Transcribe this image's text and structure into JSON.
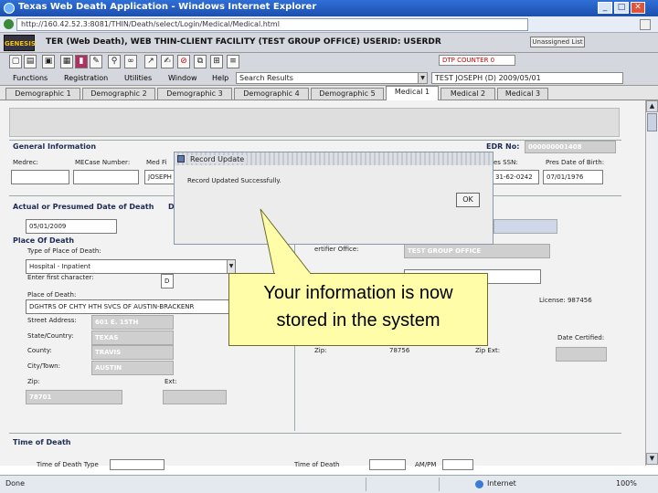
{
  "window": {
    "title": "Texas Web Death Application - Windows Internet Explorer",
    "address": "http://160.42.52.3:8081/THIN/Death/select/Login/Medical/Medical.html"
  },
  "header": {
    "logo": "GENESIS",
    "facility": "TER (Web Death), WEB THIN-CLIENT FACILITY (TEST GROUP OFFICE) USERID: USERDR",
    "unassign": "Unassigned List",
    "dtp_counter": "DTP COUNTER 0"
  },
  "menu": {
    "items": [
      "Functions",
      "Registration",
      "Utilities",
      "Window",
      "Help"
    ],
    "search_results": "Search Results",
    "patient": "TEST JOSEPH (D) 2009/05/01"
  },
  "tabs": [
    "Demographic 1",
    "Demographic 2",
    "Demographic 3",
    "Demographic 4",
    "Demographic 5",
    "Medical 1",
    "Medical 2",
    "Medical 3"
  ],
  "form": {
    "general_info": "General Information",
    "edr_label": "EDR No:",
    "edr_value": "000000001408",
    "medrec_label": "Medrec:",
    "mecase_label": "MECase Number:",
    "medfirst_label": "Med Fi",
    "medfirst_value": "JOSEPH",
    "ssn_label": "es SSN:",
    "ssn_value": "31-62-0242",
    "dob_label": "Pres Date of Birth:",
    "dob_value": "07/01/1976",
    "actual_date_label": "Actual or Presumed Date of Death",
    "actual_date_value": "05/01/2009",
    "d_label": "D",
    "place_label": "Place Of Death",
    "type_label": "Type of Place of Death:",
    "type_value": "Hospital - Inpatient",
    "first_char_label": "Enter first character:",
    "first_char_value": "D",
    "place_of_death_label": "Place of Death:",
    "place_of_death_value": "DGHTRS OF CHTY HTH SVCS OF AUSTIN-BRACKENR",
    "street_label": "Street Address:",
    "street_value": "601 E. 15TH",
    "state_label": "State/Country:",
    "state_value": "TEXAS",
    "county_label": "County:",
    "county_value": "TRAVIS",
    "city_label": "City/Town:",
    "city_value": "AUSTIN",
    "zip_label": "Zip:",
    "zip_value": "78701",
    "ext_label": "Ext:",
    "certifier_office_label": "ertifier Office:",
    "certifier_office_value": "TEST GROUP OFFICE",
    "license_label": "License: 987456",
    "date_certified_label": "Date Certified:",
    "right_zip_label": "Zip:",
    "right_zip_value": "78756",
    "right_zip_ext_label": "Zip Ext:",
    "time_of_death": "Time of Death",
    "bottom_label1": "Time of Death Type",
    "bottom_label2": "Time of Death",
    "bottom_label3": "AM/PM"
  },
  "dialog": {
    "title": "Record Update",
    "message": "Record Updated Successfully.",
    "ok": "OK"
  },
  "callout": {
    "line1": "Your information is now",
    "line2": "stored in the system"
  },
  "status": {
    "left": "Done",
    "zone": "Internet",
    "zoom": "100%"
  },
  "colors": {
    "titlebar": "#1c4fae",
    "callout": "#fffda8",
    "section_heading": "#1c2c55"
  }
}
